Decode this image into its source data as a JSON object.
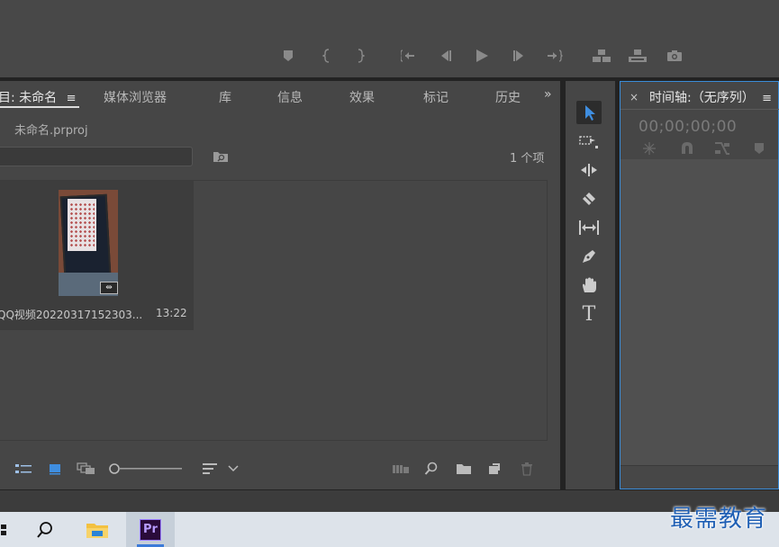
{
  "project_panel": {
    "tabs": [
      {
        "label": "目: 未命名",
        "icon": "hamburger-menu-icon"
      },
      {
        "label": "媒体浏览器"
      },
      {
        "label": "库"
      },
      {
        "label": "信息"
      },
      {
        "label": "效果"
      },
      {
        "label": "标记"
      },
      {
        "label": "历史"
      }
    ],
    "more_icon": "»",
    "file_name": "未命名.prproj",
    "item_count": "1 个项",
    "clip": {
      "name": "QQ视频20220317152303...",
      "duration": "13:22",
      "badge": "⇹"
    }
  },
  "timeline_panel": {
    "close": "×",
    "title": "时间轴:（无序列）",
    "timecode": "00;00;00;00"
  },
  "tools_panel": {
    "tools": [
      "selection-tool",
      "track-select-tool",
      "ripple-edit-tool",
      "razor-tool",
      "slip-tool",
      "pen-tool",
      "hand-tool",
      "type-tool"
    ],
    "type_glyph": "T"
  },
  "taskbar": {
    "pr_label": "Pr"
  },
  "watermark": "最需教育",
  "colors": {
    "accent": "#3a8cd8",
    "selection_tool": "#3f8ee0",
    "panel_bg": "#464646"
  }
}
